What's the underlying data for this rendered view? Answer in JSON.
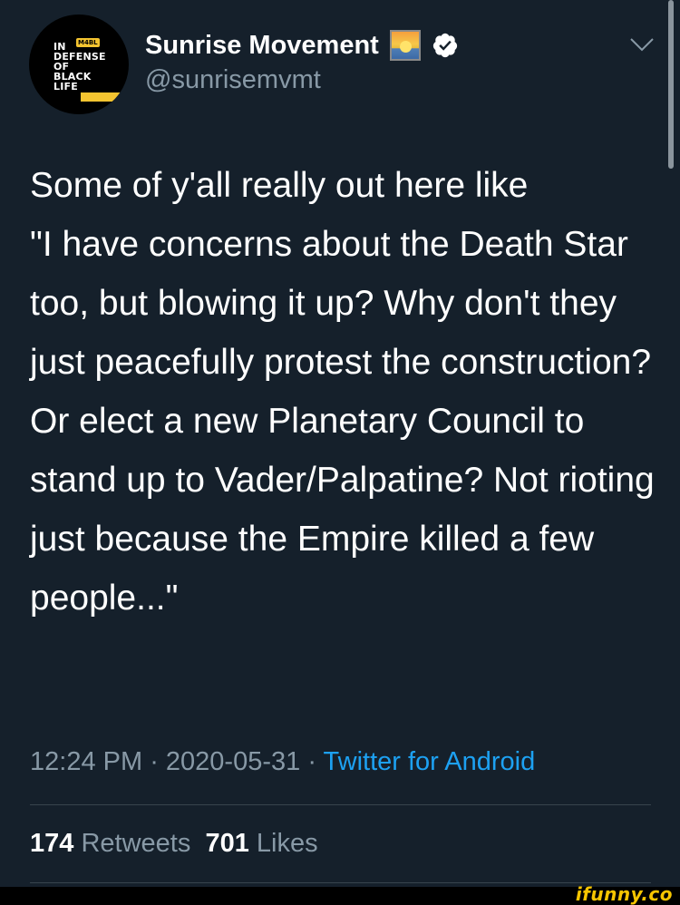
{
  "account": {
    "display_name": "Sunrise Movement",
    "handle": "@sunrisemvmt",
    "avatar_text": "IN\nDEFENSE\nOF\nBLACK\nLIFE",
    "avatar_badge": "M4BL",
    "emoji": "sunrise-emoji",
    "verified": true
  },
  "tweet": {
    "text": "Some of y'all really out here like\n\"I have concerns about the Death Star too, but blowing it up? Why don't they just peacefully protest the construction? Or elect a new Planetary Council to stand up to Vader/Palpatine? Not rioting just because the Empire killed a few people...\""
  },
  "meta": {
    "time": "12:24 PM",
    "separator": " · ",
    "date": "2020-05-31",
    "source": "Twitter for Android"
  },
  "stats": {
    "retweets_count": "174",
    "retweets_label": "Retweets",
    "likes_count": "701",
    "likes_label": "Likes"
  },
  "watermark": "ifunny.co",
  "colors": {
    "background": "#15202b",
    "secondary_text": "#8899a6",
    "link": "#1da1f2",
    "divider": "#38444d",
    "watermark": "#f6c500"
  }
}
